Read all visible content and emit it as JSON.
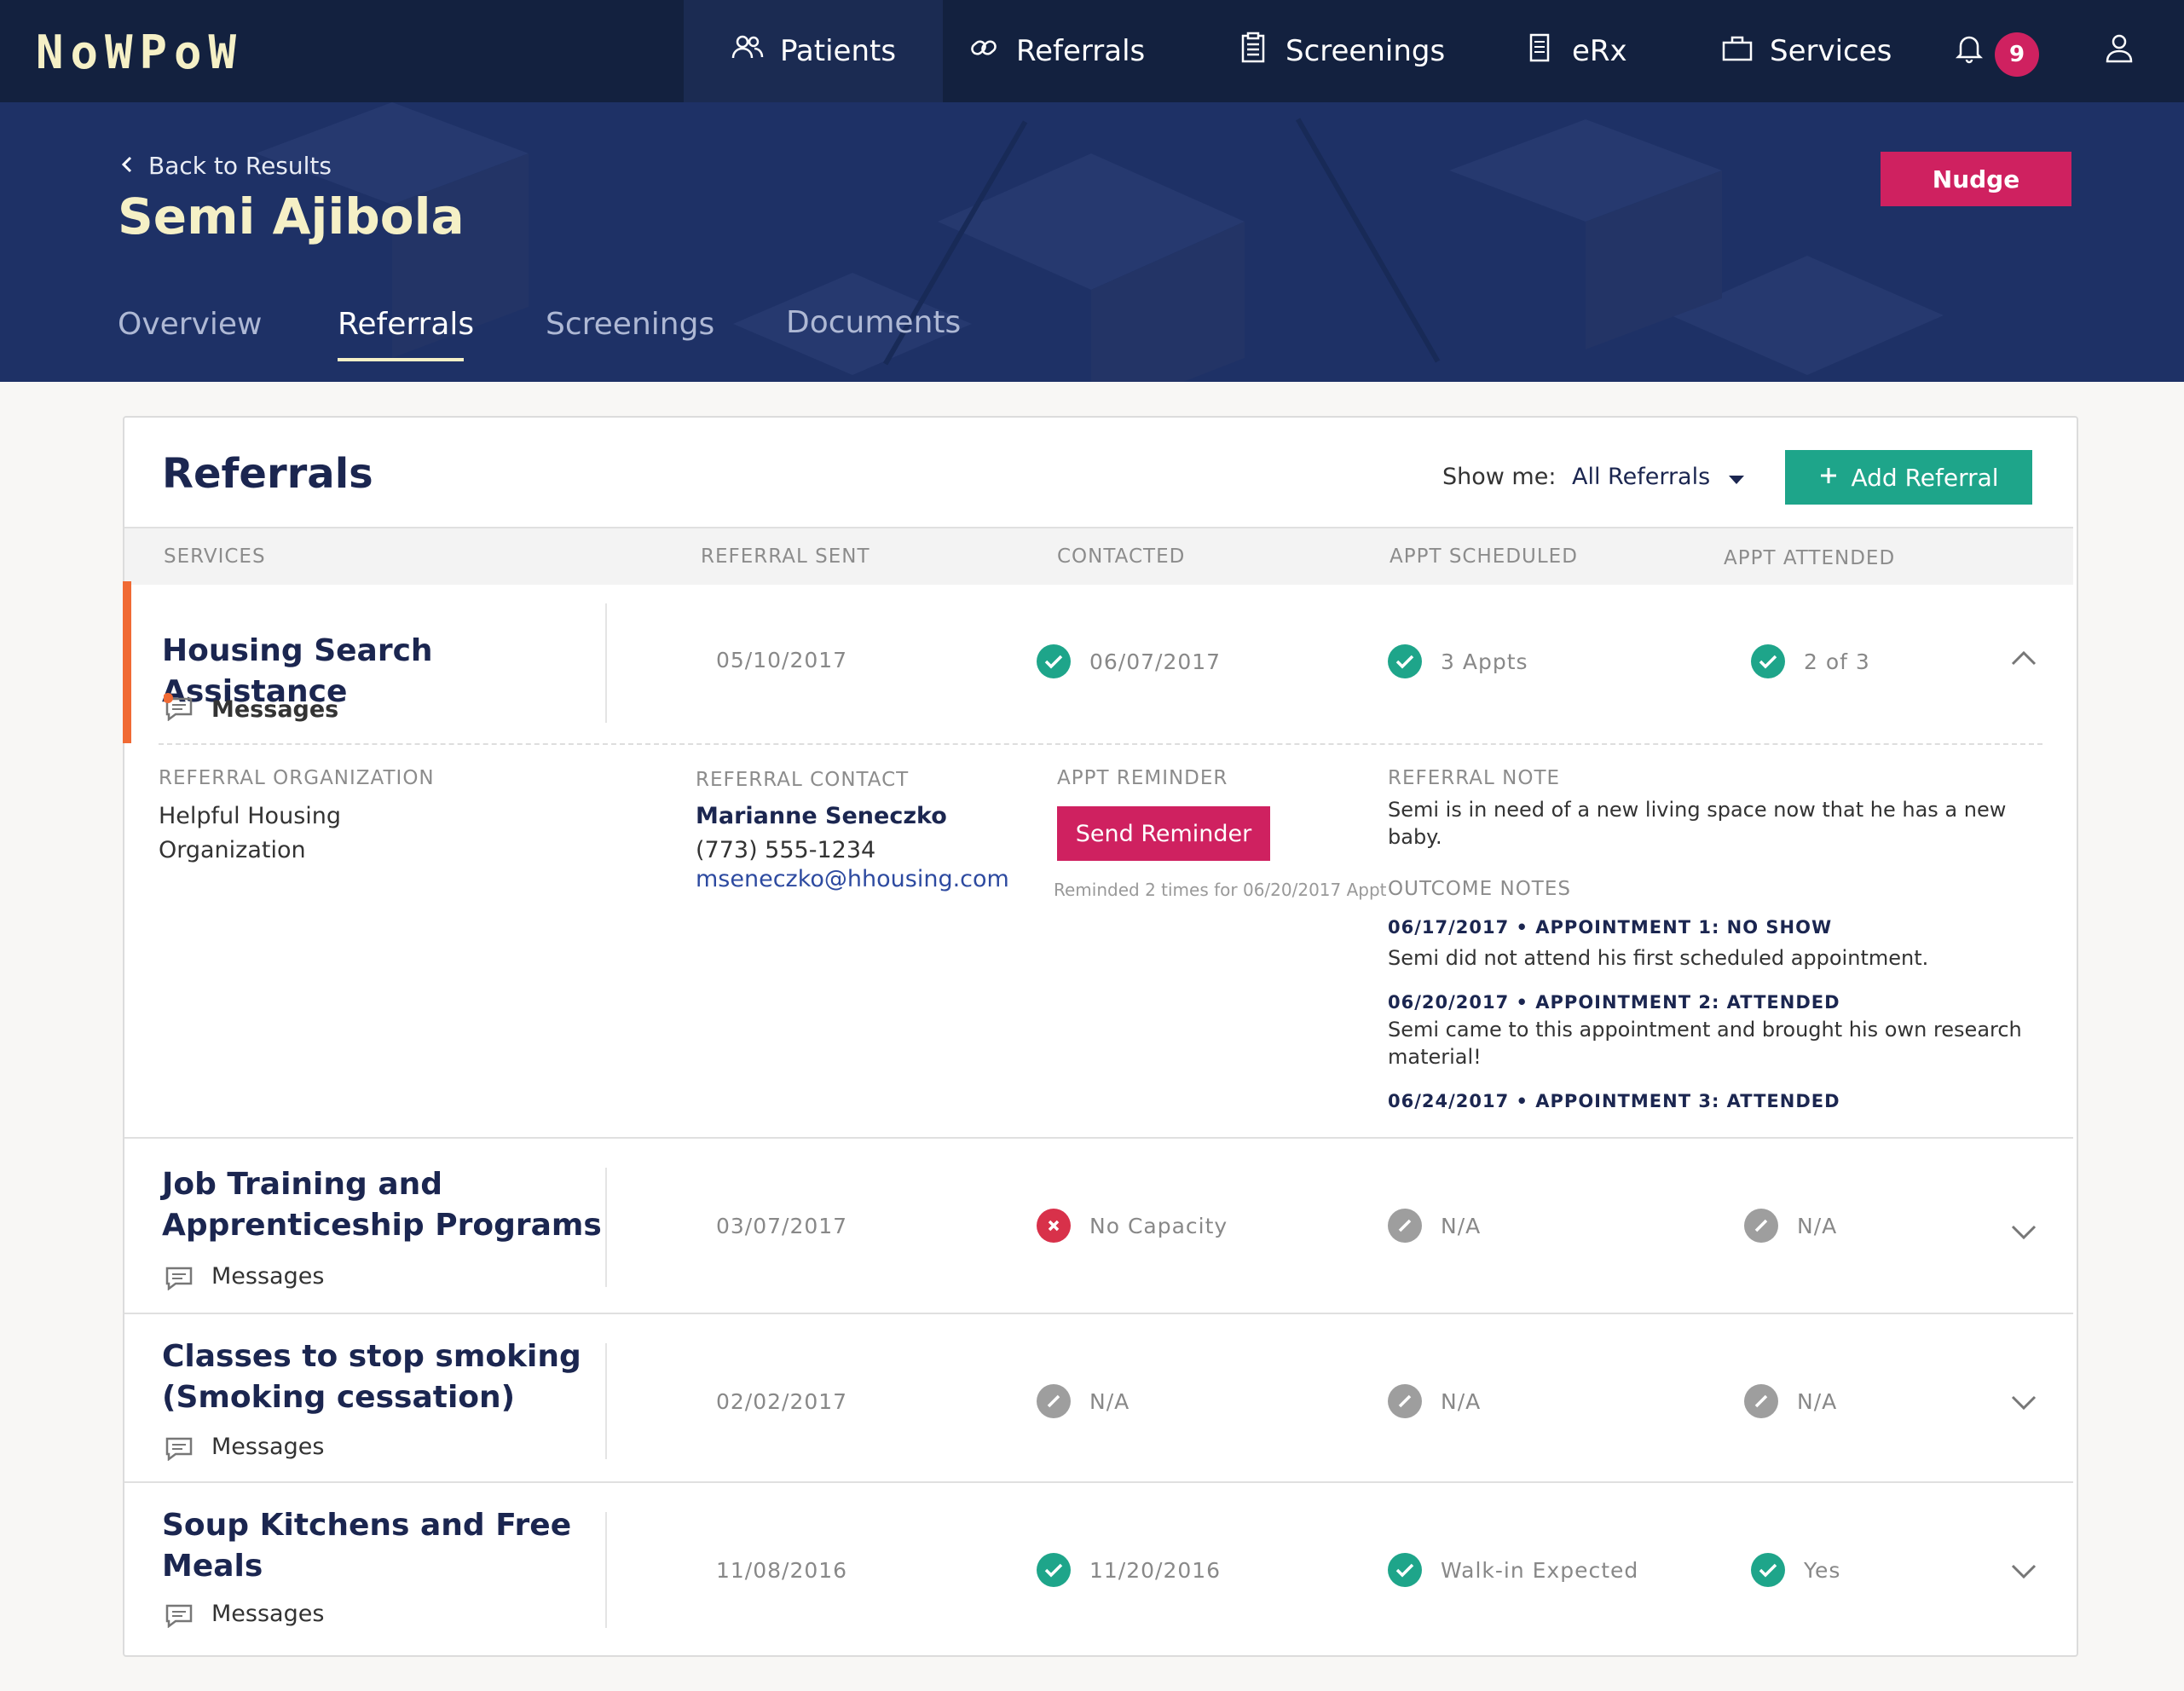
{
  "app": {
    "logo": "NoWPoW",
    "nav": {
      "patients": "Patients",
      "referrals": "Referrals",
      "screenings": "Screenings",
      "erx": "eRx",
      "services": "Services",
      "notification_count": "9"
    }
  },
  "hero": {
    "back_label": "Back to Results",
    "patient_name": "Semi Ajibola",
    "nudge_label": "Nudge",
    "tabs": {
      "overview": "Overview",
      "referrals": "Referrals",
      "screenings": "Screenings",
      "documents": "Documents"
    }
  },
  "referrals": {
    "title": "Referrals",
    "show_me_label": "Show me:",
    "filter_value": "All Referrals",
    "add_label": "Add Referral",
    "columns": {
      "services": "SERVICES",
      "sent": "REFERRAL SENT",
      "contacted": "CONTACTED",
      "scheduled": "APPT SCHEDULED",
      "attended": "APPT ATTENDED"
    },
    "rows": [
      {
        "title": "Housing Search Assistance",
        "messages": "Messages",
        "sent": "05/10/2017",
        "contacted": "06/07/2017",
        "scheduled": "3 Appts",
        "attended": "2 of 3"
      },
      {
        "title": "Job Training and Apprenticeship Programs",
        "messages": "Messages",
        "sent": "03/07/2017",
        "contacted": "No Capacity",
        "scheduled": "N/A",
        "attended": "N/A"
      },
      {
        "title": "Classes to stop smoking (Smoking cessation)",
        "messages": "Messages",
        "sent": "02/02/2017",
        "contacted": "N/A",
        "scheduled": "N/A",
        "attended": "N/A"
      },
      {
        "title": "Soup Kitchens and Free Meals",
        "messages": "Messages",
        "sent": "11/08/2016",
        "contacted": "11/20/2016",
        "scheduled": "Walk-in Expected",
        "attended": "Yes"
      }
    ],
    "detail": {
      "org_label": "REFERRAL ORGANIZATION",
      "org_line1": "Helpful Housing",
      "org_line2": "Organization",
      "contact_label": "REFERRAL CONTACT",
      "contact_name": "Marianne Seneczko",
      "contact_phone": "(773) 555-1234",
      "contact_email": "mseneczko@hhousing.com",
      "reminder_label": "APPT REMINDER",
      "reminder_button": "Send Reminder",
      "reminder_note": "Reminded 2 times for 06/20/2017 Appt",
      "note_label": "REFERRAL NOTE",
      "note_line1": "Semi is in need of a new living space now that he has a new",
      "note_line2": "baby.",
      "outcome_label": "OUTCOME NOTES",
      "outcomes": [
        {
          "head": "06/17/2017 • APPOINTMENT 1: NO SHOW",
          "line1": "Semi did not attend his first scheduled appointment.",
          "line2": ""
        },
        {
          "head": "06/20/2017 • APPOINTMENT 2: ATTENDED",
          "line1": "Semi came to this appointment and brought his own research",
          "line2": "material!"
        },
        {
          "head": "06/24/2017 • APPOINTMENT 3: ATTENDED",
          "line1": "",
          "line2": ""
        }
      ]
    }
  }
}
